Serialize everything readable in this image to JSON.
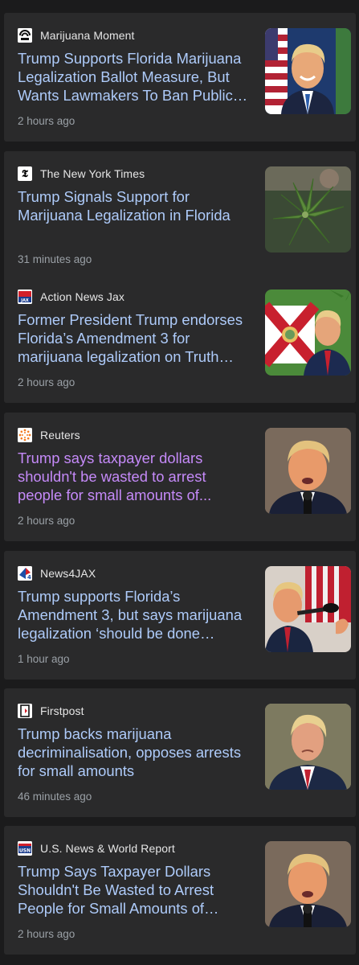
{
  "articles": [
    {
      "source": "Marijuana Moment",
      "source_icon": "marijuana-moment-logo-icon",
      "headline": "Trump Supports Florida Marijuana Legalization Ballot Measure, But Wants Lawmakers To Ban Public…",
      "time": "2 hours ago",
      "thumbnail": "trump-smiling-with-flag-photo",
      "visited": false
    },
    {
      "source": "The New York Times",
      "source_icon": "nyt-logo-icon",
      "headline": "Trump Signals Support for Marijuana Legalization in Florida",
      "time": "31 minutes ago",
      "thumbnail": "cannabis-plant-photo",
      "visited": false
    },
    {
      "source": "Action News Jax",
      "source_icon": "action-news-jax-logo-icon",
      "headline": "Former President Trump endorses Florida’s Amendment 3 for marijuana legalization on Truth…",
      "time": "2 hours ago",
      "thumbnail": "trump-florida-flag-cannabis-collage",
      "visited": false
    },
    {
      "source": "Reuters",
      "source_icon": "reuters-logo-icon",
      "headline": "Trump says taxpayer dollars shouldn't be wasted to arrest people for small amounts of...",
      "time": "2 hours ago",
      "thumbnail": "trump-speaking-photo",
      "visited": true
    },
    {
      "source": "News4JAX",
      "source_icon": "news4jax-logo-icon",
      "headline": "Trump supports Florida’s Amendment 3, but says marijuana legalization ‘should be done…",
      "time": "1 hour ago",
      "thumbnail": "trump-at-microphone-photo",
      "visited": false
    },
    {
      "source": "Firstpost",
      "source_icon": "firstpost-logo-icon",
      "headline": "Trump backs marijuana decriminalisation, opposes arrests for small amounts",
      "time": "46 minutes ago",
      "thumbnail": "trump-portrait-photo",
      "visited": false
    },
    {
      "source": "U.S. News & World Report",
      "source_icon": "usn-logo-icon",
      "headline": "Trump Says Taxpayer Dollars Shouldn't Be Wasted to Arrest People for Small Amounts of…",
      "time": "2 hours ago",
      "thumbnail": "trump-speaking-photo",
      "visited": false
    }
  ],
  "colors": {
    "background": "#1b1b1c",
    "card": "#2a2a2b",
    "headline_link": "#aecbfa",
    "headline_visited": "#c58af9",
    "source_text": "#e6e6e6",
    "timestamp": "#9aa0a6"
  }
}
